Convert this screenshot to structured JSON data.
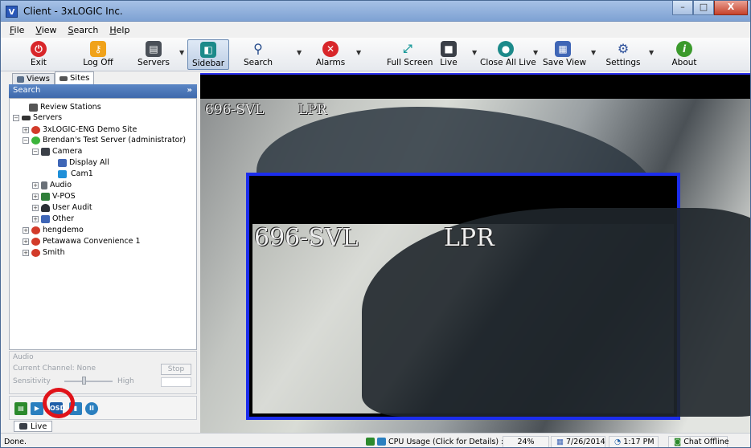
{
  "window": {
    "title": "Client - 3xLOGIC Inc.",
    "app_icon": "V",
    "minimize": "–",
    "maximize": "□",
    "close": "X"
  },
  "menu": [
    "File",
    "View",
    "Search",
    "Help"
  ],
  "toolbar": {
    "exit": "Exit",
    "log_off": "Log Off",
    "servers": "Servers",
    "sidebar": "Sidebar",
    "search": "Search",
    "alarms": "Alarms",
    "full_screen": "Full Screen",
    "live": "Live",
    "close_all_live": "Close All Live",
    "save_view": "Save View",
    "settings": "Settings",
    "about": "About"
  },
  "left_panel": {
    "tabs": {
      "views": "Views",
      "sites": "Sites"
    },
    "search_label": "Search",
    "tree": {
      "review_stations": "Review Stations",
      "servers": "Servers",
      "demo_site": "3xLOGIC-ENG Demo Site",
      "test_server": "Brendan's Test Server (administrator)",
      "camera": "Camera",
      "display_all": "Display All",
      "cam1": "Cam1",
      "audio": "Audio",
      "vpos": "V-POS",
      "user_audit": "User Audit",
      "other": "Other",
      "hengdemo": "hengdemo",
      "petawawa": "Petawawa Convenience 1",
      "smith": "Smith"
    },
    "audio": {
      "heading": "Audio",
      "current_channel": "Current Channel: None",
      "stop": "Stop",
      "sensitivity": "Sensitivity",
      "high": "High"
    },
    "live_tab": "Live"
  },
  "video": {
    "overlay_plate": "696-SVL",
    "overlay_tag": "LPR"
  },
  "status": {
    "left": "Done.",
    "cpu_label": "CPU Usage (Click for Details) :",
    "cpu_value": "24%",
    "date": "7/26/2014",
    "time": "1:17 PM",
    "chat": "Chat Offline"
  }
}
